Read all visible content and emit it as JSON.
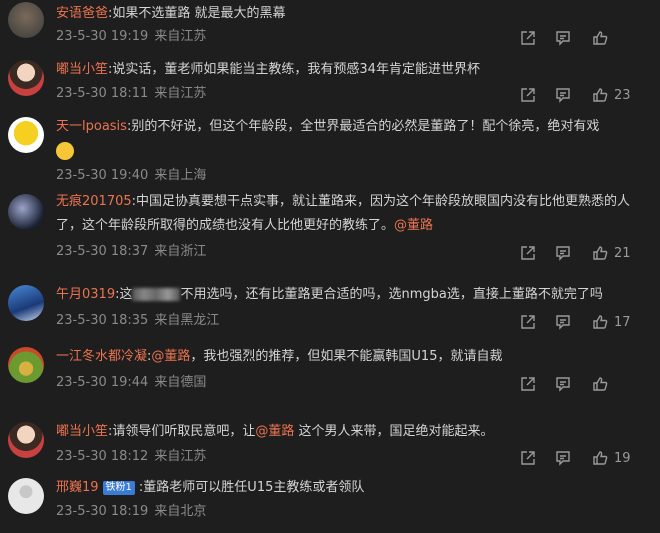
{
  "comments": [
    {
      "user": "安语爸爸",
      "text": ":如果不选董路 就是最大的黑幕",
      "time": "23-5-30 19:19",
      "location": "来自江苏",
      "likes": ""
    },
    {
      "user": "嘟当小笙",
      "text": ":说实话，董老师如果能当主教练，我有预感34年肯定能进世界杯",
      "time": "23-5-30 18:11",
      "location": "来自江苏",
      "likes": "23"
    },
    {
      "user": "天一lpoasis",
      "text": ":别的不好说，但这个年龄段，全世界最适合的必然是董路了！配个徐亮，绝对有戏",
      "time": "23-5-30 19:40",
      "location": "来自上海",
      "likes": ""
    },
    {
      "user": "无痕201705",
      "text": ":中国足协真要想干点实事，就让董路来，因为这个年龄段放眼国内没有比他更熟悉的人了，这个年龄段所取得的成绩也没有人比他更好的教练了。",
      "mention": "@董路",
      "time": "23-5-30 18:37",
      "location": "来自浙江",
      "likes": "21"
    },
    {
      "user": "午月0319",
      "text_pre": ":这",
      "text_post": "不用选吗，还有比董路更合适的吗，选nmgba选，直接上董路不就完了吗",
      "time": "23-5-30 18:35",
      "location": "来自黑龙江",
      "likes": "17"
    },
    {
      "user": "一江冬水都冷凝",
      "text_pre": ":",
      "mention": "@董路",
      "text_post": "，我也强烈的推荐，但如果不能赢韩国U15，就请自裁",
      "time": "23-5-30 19:44",
      "location": "来自德国",
      "likes": ""
    },
    {
      "user": "嘟当小笙",
      "text_pre": ":请领导们听取民意吧，让",
      "mention": "@董路",
      "text_post": " 这个男人来带，国足绝对能起来。",
      "time": "23-5-30 18:12",
      "location": "来自江苏",
      "likes": "19"
    },
    {
      "user": "邢巍19",
      "badge": "铁粉1",
      "text": ":董路老师可以胜任U15主教练或者领队",
      "time": "23-5-30 18:19",
      "location": "来自北京",
      "likes": ""
    }
  ],
  "colors": {
    "background": "#1e1e1e",
    "username": "#eb7350",
    "meta": "#8a8a8a"
  },
  "icons": {
    "share": "share-icon",
    "reply": "comment-icon",
    "like": "thumbs-up-icon"
  }
}
